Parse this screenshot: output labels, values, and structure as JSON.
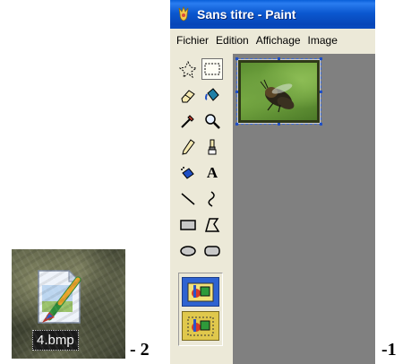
{
  "desktop_file": {
    "name": "4.bmp",
    "icon": "bitmap-file-icon"
  },
  "step_labels": {
    "left": "- 2",
    "right": "-1"
  },
  "paint_window": {
    "title": "Sans titre - Paint",
    "app_icon": "paint-app-icon",
    "menu": [
      "Fichier",
      "Edition",
      "Affichage",
      "Image"
    ],
    "tools": [
      {
        "name": "free-form-select-icon",
        "selected": false
      },
      {
        "name": "rect-select-icon",
        "selected": true
      },
      {
        "name": "eraser-icon",
        "selected": false
      },
      {
        "name": "fill-bucket-icon",
        "selected": false
      },
      {
        "name": "color-picker-icon",
        "selected": false
      },
      {
        "name": "magnifier-icon",
        "selected": false
      },
      {
        "name": "pencil-icon",
        "selected": false
      },
      {
        "name": "brush-icon",
        "selected": false
      },
      {
        "name": "airbrush-icon",
        "selected": false
      },
      {
        "name": "text-tool-icon",
        "label": "A",
        "selected": false
      },
      {
        "name": "line-icon",
        "selected": false
      },
      {
        "name": "curve-icon",
        "selected": false
      },
      {
        "name": "rectangle-icon",
        "selected": false
      },
      {
        "name": "polygon-icon",
        "selected": false
      },
      {
        "name": "ellipse-icon",
        "selected": false
      },
      {
        "name": "rounded-rect-icon",
        "selected": false
      }
    ],
    "options": [
      "opaque-selection-icon",
      "transparent-selection-icon"
    ],
    "colors": {
      "titlebar": "#0a5fd9",
      "window_bg": "#ece9d8",
      "canvas_bg": "#808080",
      "selection": "#2f63d1"
    }
  }
}
